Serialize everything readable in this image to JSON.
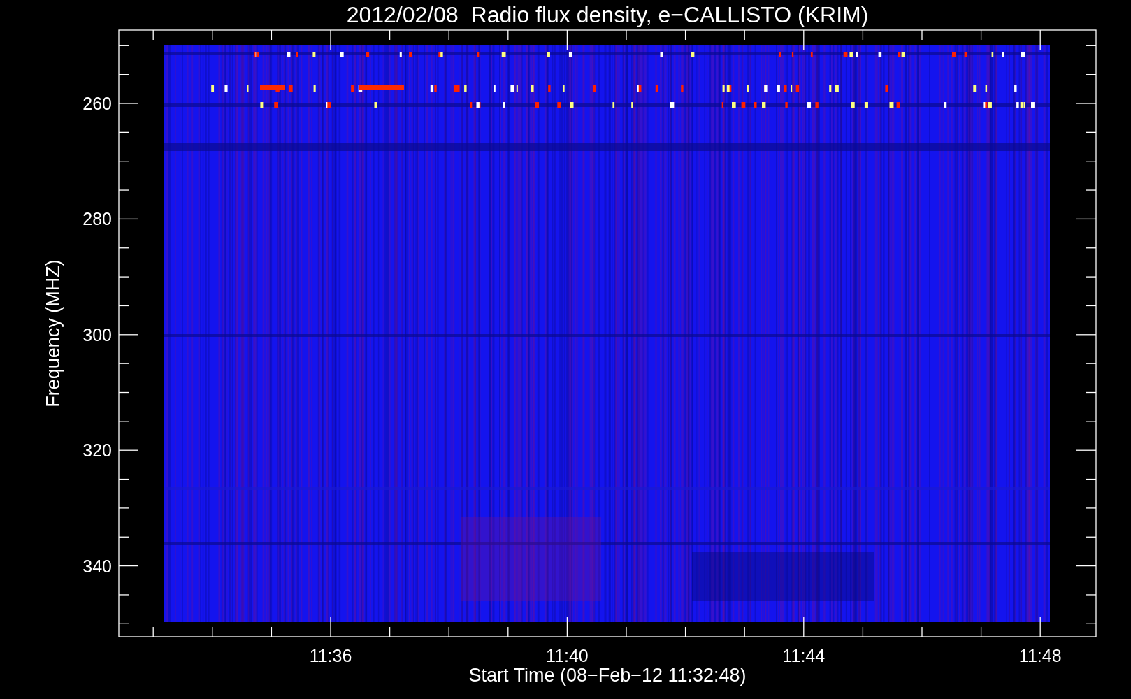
{
  "title": "2012/02/08  Radio flux density, e−CALLISTO (KRIM)",
  "ylabel": "Frequency (MHZ)",
  "xlabel": "Start Time (08−Feb−12 11:32:48)",
  "yticks": [
    "260",
    "280",
    "300",
    "320",
    "340"
  ],
  "xticks": [
    "11:36",
    "11:40",
    "11:44",
    "11:48"
  ]
}
